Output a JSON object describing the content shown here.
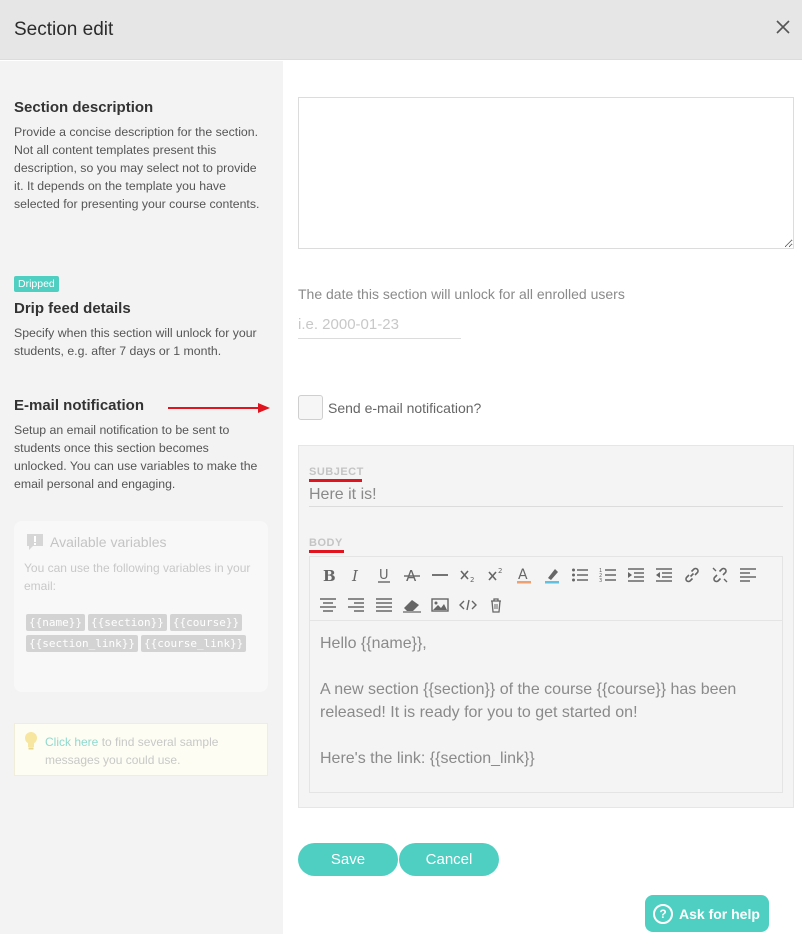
{
  "header": {
    "title": "Section edit"
  },
  "description": {
    "title": "Section description",
    "text": "Provide a concise description for the section. Not all content templates present this description, so you may select not to provide it. It depends on the template you have selected for presenting your course contents.",
    "value": ""
  },
  "drip": {
    "badge": "Dripped",
    "title": "Drip feed details",
    "text": "Specify when this section will unlock for your students, e.g. after 7 days or 1 month.",
    "field_label": "The date this section will unlock for all enrolled users",
    "placeholder": "i.e. 2000-01-23"
  },
  "email": {
    "title": "E-mail notification",
    "text": "Setup an email notification to be sent to students once this section becomes unlocked. You can use variables to make the email personal and engaging.",
    "checkbox_label": "Send e-mail notification?",
    "subject_label": "SUBJECT",
    "subject_value": "Here it is!",
    "body_label": "BODY",
    "body_lines": [
      "Hello {{name}},",
      "A new section {{section}} of the course {{course}} has been released! It is ready for you to get started on!",
      "Here's the link: {{section_link}}"
    ]
  },
  "variables": {
    "title": "Available variables",
    "text": "You can use the following variables in your email:",
    "chips": [
      "{{name}}",
      "{{section}}",
      "{{course}}",
      "{{section_link}}",
      "{{course_link}}"
    ]
  },
  "tip": {
    "link": "Click here",
    "text": " to find several sample messages you could use."
  },
  "buttons": {
    "save": "Save",
    "cancel": "Cancel",
    "help": "Ask for help"
  },
  "colors": {
    "accent": "#4fcfc2",
    "underline": "#e0141e",
    "arrow": "#e0141e"
  }
}
